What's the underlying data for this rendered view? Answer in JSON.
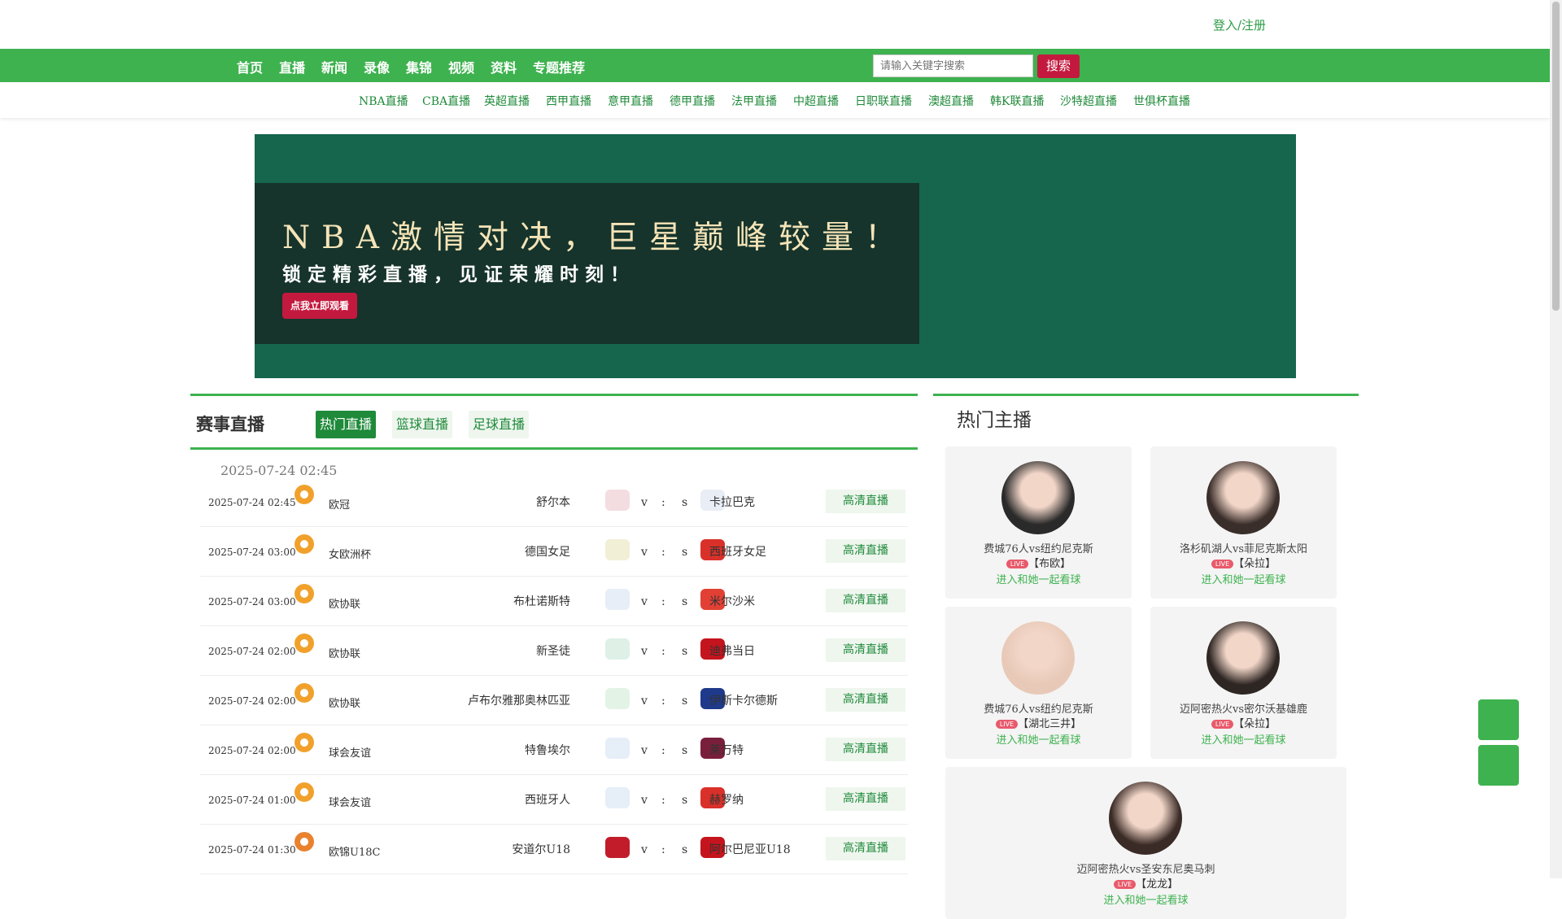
{
  "header": {
    "login_label": "登入/注册"
  },
  "nav": {
    "items": [
      "首页",
      "直播",
      "新闻",
      "录像",
      "集锦",
      "视频",
      "资料",
      "专题推荐"
    ],
    "search_placeholder": "请输入关键字搜索",
    "search_button": "搜索"
  },
  "subnav": {
    "items": [
      "NBA直播",
      "CBA直播",
      "英超直播",
      "西甲直播",
      "意甲直播",
      "德甲直播",
      "法甲直播",
      "中超直播",
      "日职联直播",
      "澳超直播",
      "韩K联直播",
      "沙特超直播",
      "世俱杯直播"
    ]
  },
  "banner": {
    "title": "NBA激情对决，巨星巅峰较量！",
    "subtitle": "锁定精彩直播，见证荣耀时刻！",
    "button": "点我立即观看",
    "colors": {
      "background": "#15664c",
      "inner": "#16342b",
      "title": "#f5e4b8",
      "button": "#c4193f"
    }
  },
  "schedule": {
    "title": "赛事直播",
    "tabs": [
      "热门直播",
      "篮球直播",
      "足球直播"
    ],
    "active_tab": "热门直播",
    "date_header": "2025-07-24 02:45",
    "vs_left": "v",
    "vs_mid": ":",
    "vs_right": "s",
    "hd_label": "高清直播",
    "rows": [
      {
        "time": "2025-07-24 02:45",
        "sport": "football-icon",
        "league": "欧冠",
        "home": "舒尔本",
        "away": "卡拉巴克"
      },
      {
        "time": "2025-07-24 03:00",
        "sport": "football-icon",
        "league": "女欧洲杯",
        "home": "德国女足",
        "away": "西班牙女足"
      },
      {
        "time": "2025-07-24 03:00",
        "sport": "football-icon",
        "league": "欧协联",
        "home": "布杜诺斯特",
        "away": "米尔沙米"
      },
      {
        "time": "2025-07-24 02:00",
        "sport": "football-icon",
        "league": "欧协联",
        "home": "新圣徒",
        "away": "迪弗当日"
      },
      {
        "time": "2025-07-24 02:00",
        "sport": "football-icon",
        "league": "欧协联",
        "home": "卢布尔雅那奥林匹亚",
        "away": "伊斯卡尔德斯"
      },
      {
        "time": "2025-07-24 02:00",
        "sport": "football-icon",
        "league": "球会友谊",
        "home": "特鲁埃尔",
        "away": "莱万特"
      },
      {
        "time": "2025-07-24 01:00",
        "sport": "football-icon",
        "league": "球会友谊",
        "home": "西班牙人",
        "away": "赫罗纳"
      },
      {
        "time": "2025-07-24 01:30",
        "sport": "basketball-icon",
        "league": "欧锦U18C",
        "home": "安道尔U18",
        "away": "阿尔巴尼亚U18"
      }
    ]
  },
  "hosts": {
    "title": "热门主播",
    "live_label": "LIVE",
    "enter_label": "进入和她一起看球",
    "cards": [
      {
        "match": "费城76人vs纽约尼克斯",
        "host": "【布欧】"
      },
      {
        "match": "洛杉矶湖人vs菲尼克斯太阳",
        "host": "【朵拉】"
      },
      {
        "match": "费城76人vs纽约尼克斯",
        "host": "【湖北三井】"
      },
      {
        "match": "迈阿密热火vs密尔沃基雄鹿",
        "host": "【朵拉】"
      },
      {
        "match": "迈阿密热火vs圣安东尼奥马刺",
        "host": "【龙龙】"
      }
    ]
  },
  "theme": {
    "green": "#3eb24f",
    "dark_green": "#1f8a3a",
    "red": "#c4193f"
  }
}
